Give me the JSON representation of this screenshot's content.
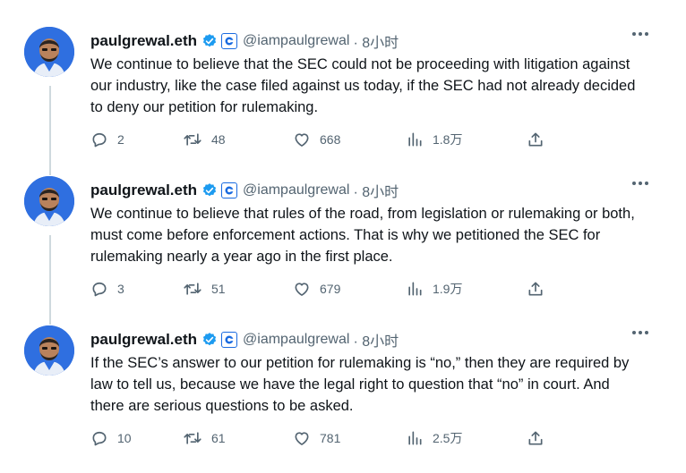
{
  "tweets": [
    {
      "name": "paulgrewal.eth",
      "handle": "@iampaulgrewal",
      "time": "· 8小时",
      "text": "We continue to believe that the SEC could not be proceeding with litigation against our industry, like the case filed against us today, if the SEC had not already decided to deny our petition for rulemaking.",
      "replies": "2",
      "retweets": "48",
      "likes": "668",
      "views": "1.8万"
    },
    {
      "name": "paulgrewal.eth",
      "handle": "@iampaulgrewal",
      "time": "· 8小时",
      "text": "We continue to believe that rules of the road, from legislation or rulemaking or both, must come before enforcement actions. That is why we petitioned the SEC for rulemaking nearly a year ago in the first place.",
      "replies": "3",
      "retweets": "51",
      "likes": "679",
      "views": "1.9万"
    },
    {
      "name": "paulgrewal.eth",
      "handle": "@iampaulgrewal",
      "time": "· 8小时",
      "text": "If the SEC’s answer to our petition for rulemaking is “no,” then they are required by law to tell us, because we have the legal right to question that “no” in court. And there are serious questions to be asked.",
      "replies": "10",
      "retweets": "61",
      "likes": "781",
      "views": "2.5万"
    }
  ],
  "colors": {
    "text": "#0f1419",
    "secondary": "#536471",
    "verified": "#1d9bf0",
    "affiliate": "#1a6be0",
    "thread_line": "#cfd9de",
    "avatar_bg": "#2f6fe0"
  },
  "icons": [
    "avatar",
    "verified-badge-icon",
    "affiliate-badge-icon",
    "more-icon",
    "reply-icon",
    "retweet-icon",
    "like-icon",
    "views-icon",
    "share-icon"
  ]
}
